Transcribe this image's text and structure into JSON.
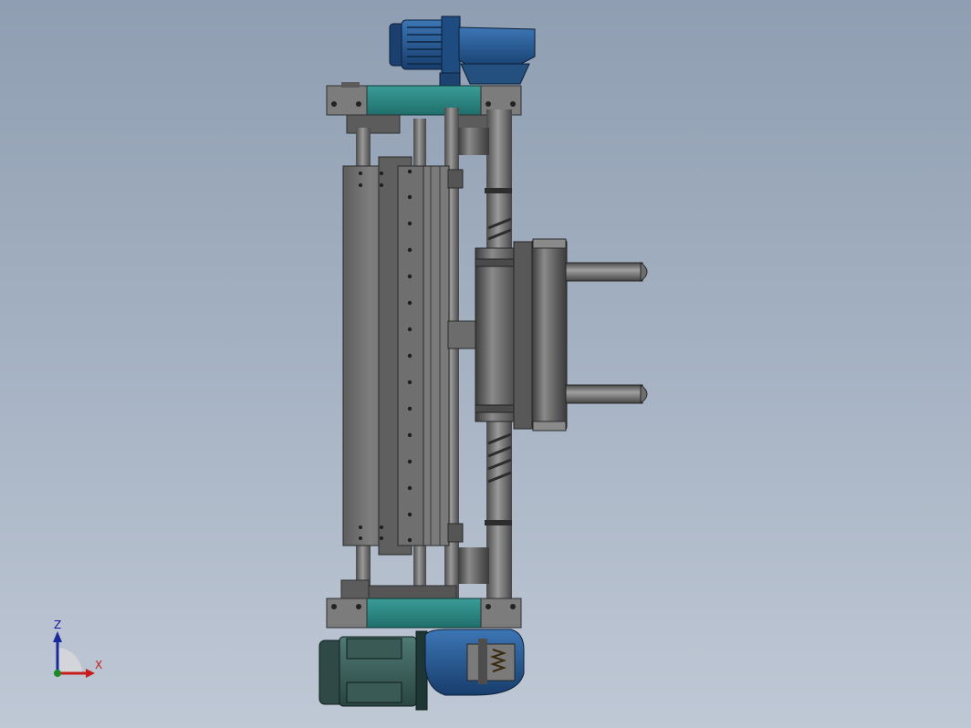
{
  "triad": {
    "z_label": "Z",
    "x_label": "X",
    "z_color": "#1a2a9a",
    "x_color": "#c81c1c",
    "y_color": "#1a8a2a"
  },
  "colors": {
    "background_top": "#8f9eb2",
    "background_bottom": "#bfc8d5",
    "frame_teal": "#2b8a86",
    "motor_blue": "#24518a",
    "motor_green": "#3b5f5a",
    "steel": "#6e6e6e"
  }
}
